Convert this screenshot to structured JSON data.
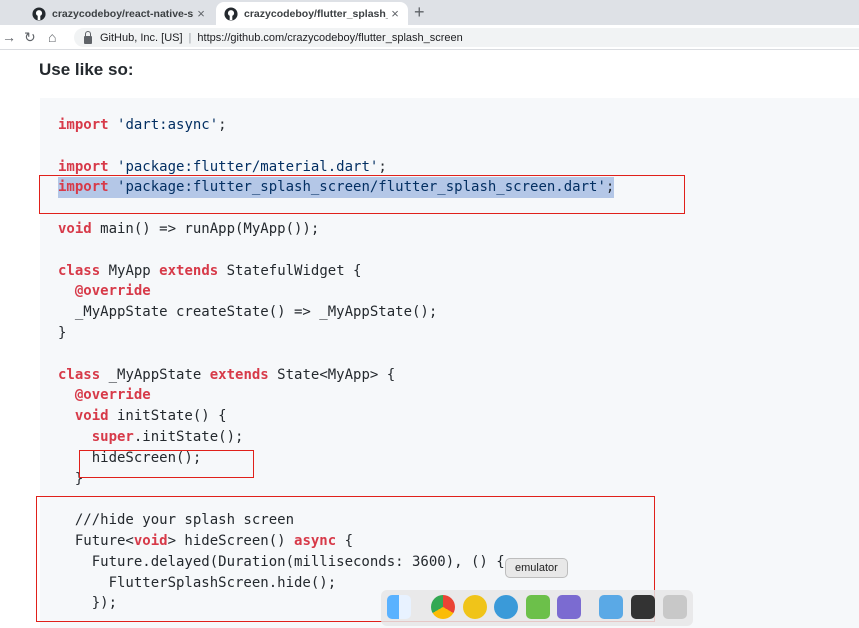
{
  "tabs": [
    {
      "title": "crazycodeboy/react-native-sp",
      "close": "×"
    },
    {
      "title": "crazycodeboy/flutter_splash_s",
      "close": "×"
    }
  ],
  "new_tab": "+",
  "address": {
    "back": "→",
    "reload": "↻",
    "home": "⌂",
    "org": "GitHub, Inc. [US]",
    "separator": "|",
    "url": "https://github.com/crazycodeboy/flutter_splash_screen"
  },
  "page": {
    "heading": "Use like so:"
  },
  "code_lines": [
    "import 'dart:async';",
    "",
    "import 'package:flutter/material.dart';",
    "import 'package:flutter_splash_screen/flutter_splash_screen.dart';",
    "",
    "void main() => runApp(MyApp());",
    "",
    "class MyApp extends StatefulWidget {",
    "  @override",
    "  _MyAppState createState() => _MyAppState();",
    "}",
    "",
    "class _MyAppState extends State<MyApp> {",
    "  @override",
    "  void initState() {",
    "    super.initState();",
    "    hideScreen();",
    "  }",
    "",
    "  ///hide your splash screen",
    "  Future<void> hideScreen() async {",
    "    Future.delayed(Duration(milliseconds: 3600), () {",
    "      FlutterSplashScreen.hide();",
    "    });"
  ],
  "dock": {
    "tooltip": "emulator",
    "icons": [
      "finder-icon",
      "chrome-icon",
      "android-studio-icon",
      "quicktime-icon",
      "emulator-icon",
      "simulator-icon",
      "folder-icon",
      "terminal-icon",
      "trash-icon"
    ]
  },
  "colors": {
    "highlight_box": "#e0201a",
    "selection": "#b4c7e7",
    "keyword": "#d73a49",
    "string": "#032f62"
  }
}
